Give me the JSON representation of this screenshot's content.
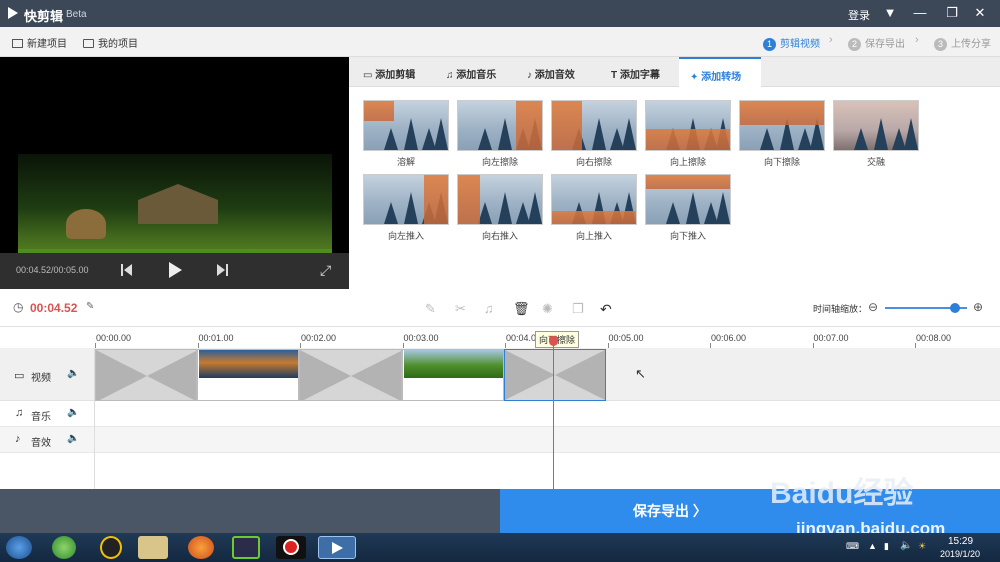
{
  "window": {
    "title": "快剪辑",
    "beta": "Beta",
    "login": "登录"
  },
  "toolbar": {
    "new_project": "新建项目",
    "my_projects": "我的项目"
  },
  "steps": [
    {
      "num": "1",
      "label": "剪辑视频",
      "active": true
    },
    {
      "num": "2",
      "label": "保存导出",
      "active": false
    },
    {
      "num": "3",
      "label": "上传分享",
      "active": false
    }
  ],
  "preview": {
    "timecode": "00:04.52/00:05.00"
  },
  "tabs": [
    {
      "label": "添加剪辑",
      "active": false
    },
    {
      "label": "添加音乐",
      "active": false
    },
    {
      "label": "添加音效",
      "active": false
    },
    {
      "label": "添加字幕",
      "active": false
    },
    {
      "label": "添加转场",
      "active": true
    }
  ],
  "transitions": [
    "溶解",
    "向左擦除",
    "向右擦除",
    "向上擦除",
    "向下擦除",
    "交融",
    "向左推入",
    "向右推入",
    "向上推入",
    "向下推入"
  ],
  "timeline": {
    "current_time": "00:04.52",
    "zoom_label": "时间轴缩放：",
    "ruler": [
      "00:00.00",
      "00:01.00",
      "00:02.00",
      "00:03.00",
      "00:04.00",
      "00:05.00",
      "00:06.00",
      "00:07.00",
      "00:08.00"
    ],
    "tracks": {
      "video": "视频",
      "music": "音乐",
      "sfx": "音效"
    },
    "tooltip": "向下擦除"
  },
  "export": {
    "label": "保存导出 〉"
  },
  "taskbar": {
    "time": "15:29",
    "date": "2019/1/20"
  },
  "watermark": {
    "brand": "Baidu经验",
    "url": "jingyan.baidu.com"
  },
  "colors": {
    "accent": "#2f8bec",
    "time": "#d9534f",
    "titlebar": "#3c4857"
  }
}
